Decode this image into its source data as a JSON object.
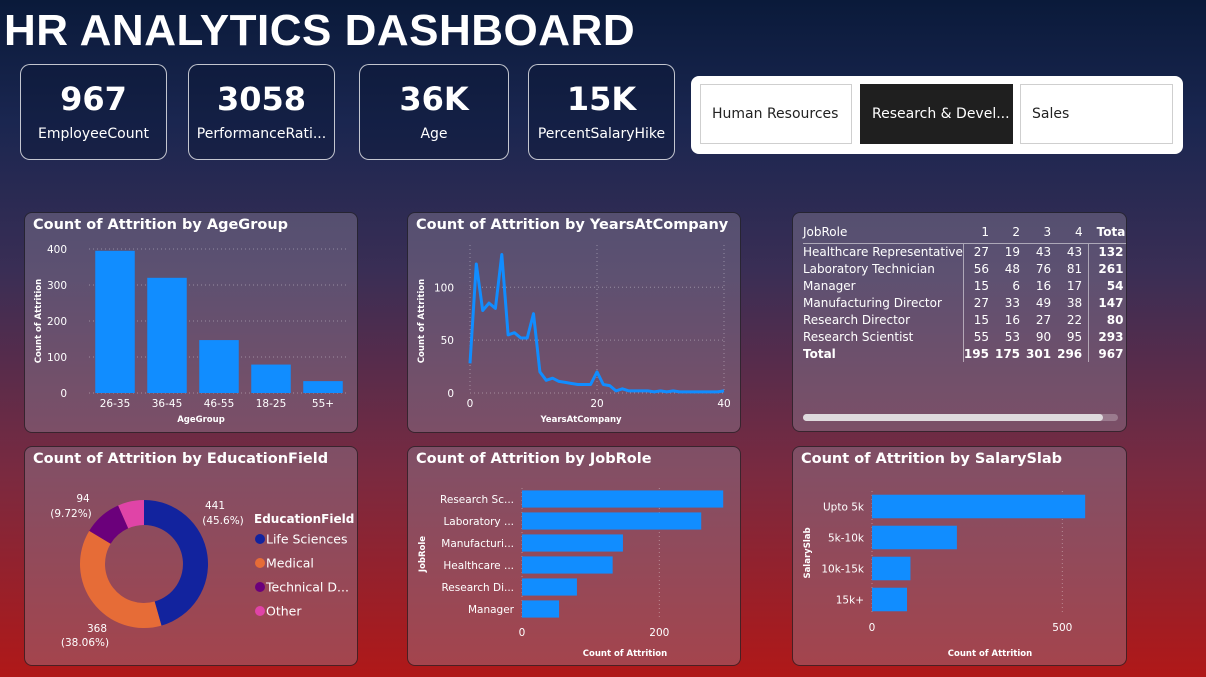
{
  "title": "HR ANALYTICS DASHBOARD",
  "kpis": [
    {
      "value": "967",
      "label": "EmployeeCount"
    },
    {
      "value": "3058",
      "label": "PerformanceRati..."
    },
    {
      "value": "36K",
      "label": "Age"
    },
    {
      "value": "15K",
      "label": "PercentSalaryHike"
    }
  ],
  "slicer": {
    "options": [
      "Human Resources",
      "Research & Devel...",
      "Sales"
    ],
    "selected": "Research & Devel..."
  },
  "colors": {
    "bar": "#118dff",
    "life_sciences": "#12239e",
    "medical": "#e66c37",
    "technical": "#6b007b",
    "other": "#e044a7"
  },
  "age_chart": {
    "title": "Count of Attrition by AgeGroup"
  },
  "years_chart": {
    "title": "Count of Attrition by YearsAtCompany"
  },
  "edu_chart": {
    "title": "Count of Attrition by EducationField",
    "legend_title": "EducationField"
  },
  "job_chart": {
    "title": "Count of Attrition by JobRole"
  },
  "salary_chart": {
    "title": "Count of Attrition by SalarySlab"
  },
  "matrix": {
    "headers": [
      "JobRole",
      "1",
      "2",
      "3",
      "4",
      "Total"
    ],
    "rows": [
      [
        "Healthcare Representative",
        "27",
        "19",
        "43",
        "43",
        "132"
      ],
      [
        "Laboratory Technician",
        "56",
        "48",
        "76",
        "81",
        "261"
      ],
      [
        "Manager",
        "15",
        "6",
        "16",
        "17",
        "54"
      ],
      [
        "Manufacturing Director",
        "27",
        "33",
        "49",
        "38",
        "147"
      ],
      [
        "Research Director",
        "15",
        "16",
        "27",
        "22",
        "80"
      ],
      [
        "Research Scientist",
        "55",
        "53",
        "90",
        "95",
        "293"
      ]
    ],
    "total": [
      "Total",
      "195",
      "175",
      "301",
      "296",
      "967"
    ]
  },
  "chart_data": [
    {
      "type": "bar",
      "title": "Count of Attrition by AgeGroup",
      "xlabel": "AgeGroup",
      "ylabel": "Count of Attrition",
      "categories": [
        "26-35",
        "36-45",
        "46-55",
        "18-25",
        "55+"
      ],
      "values": [
        395,
        320,
        147,
        79,
        33
      ],
      "ylim": [
        0,
        400
      ],
      "yticks": [
        "0",
        "100",
        "200",
        "300",
        "400"
      ]
    },
    {
      "type": "line",
      "title": "Count of Attrition by YearsAtCompany",
      "xlabel": "YearsAtCompany",
      "ylabel": "Count of Attrition",
      "x": [
        0,
        1,
        2,
        3,
        4,
        5,
        6,
        7,
        8,
        9,
        10,
        11,
        12,
        13,
        14,
        15,
        16,
        17,
        18,
        19,
        20,
        21,
        22,
        23,
        24,
        25,
        26,
        27,
        28,
        29,
        30,
        31,
        32,
        33,
        34,
        35,
        36,
        37,
        38,
        39,
        40
      ],
      "values": [
        28,
        122,
        78,
        85,
        80,
        131,
        55,
        57,
        52,
        52,
        75,
        20,
        12,
        14,
        11,
        10,
        9,
        8,
        8,
        8,
        20,
        8,
        7,
        2,
        4,
        2,
        2,
        2,
        2,
        1,
        2,
        1,
        2,
        1,
        1,
        1,
        1,
        1,
        1,
        1,
        2
      ],
      "xlim": [
        0,
        40
      ],
      "ylim": [
        0,
        140
      ],
      "xticks": [
        "0",
        "20",
        "40"
      ],
      "yticks": [
        "0",
        "50",
        "100"
      ]
    },
    {
      "type": "pie",
      "title": "Count of Attrition by EducationField",
      "legend_title": "EducationField",
      "labels": [
        "Life Sciences",
        "Medical",
        "Technical D...",
        "Other"
      ],
      "values": [
        441,
        368,
        94,
        64
      ],
      "data_labels": [
        {
          "value": "441",
          "pct": "(45.6%)"
        },
        {
          "value": "368",
          "pct": "(38.06%)"
        },
        {
          "value": "94",
          "pct": "(9.72%)"
        }
      ]
    },
    {
      "type": "bar",
      "orientation": "horizontal",
      "title": "Count of Attrition by JobRole",
      "xlabel": "Count of Attrition",
      "ylabel": "JobRole",
      "categories": [
        "Research Sc...",
        "Laboratory ...",
        "Manufacturi...",
        "Healthcare ...",
        "Research Di...",
        "Manager"
      ],
      "values": [
        293,
        261,
        147,
        132,
        80,
        54
      ],
      "xlim": [
        0,
        300
      ],
      "xticks": [
        "0",
        "200"
      ]
    },
    {
      "type": "bar",
      "orientation": "horizontal",
      "title": "Count of Attrition by SalarySlab",
      "xlabel": "Count of Attrition",
      "ylabel": "SalarySlab",
      "categories": [
        "Upto 5k",
        "5k-10k",
        "10k-15k",
        "15k+"
      ],
      "values": [
        560,
        223,
        101,
        92
      ],
      "xlim": [
        0,
        620
      ],
      "xticks": [
        "0",
        "500"
      ]
    }
  ]
}
